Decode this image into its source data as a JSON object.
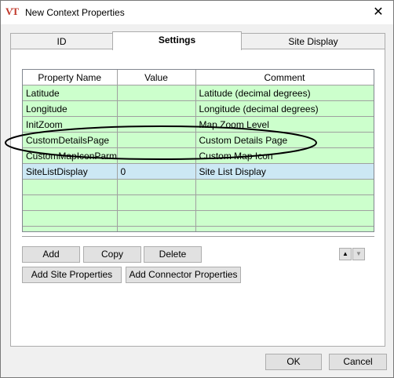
{
  "window": {
    "title": "New Context Properties",
    "app_icon": "VT",
    "close_glyph": "✕"
  },
  "tabs": [
    {
      "label": "ID"
    },
    {
      "label": "Settings"
    },
    {
      "label": "Site Display"
    }
  ],
  "active_tab": "Settings",
  "grid": {
    "columns": [
      "Property Name",
      "Value",
      "Comment"
    ],
    "rows": [
      {
        "name": "Latitude",
        "value": "",
        "comment": "Latitude (decimal degrees)"
      },
      {
        "name": "Longitude",
        "value": "",
        "comment": "Longitude (decimal degrees)"
      },
      {
        "name": "InitZoom",
        "value": "",
        "comment": "Map Zoom Level"
      },
      {
        "name": "CustomDetailsPage",
        "value": "",
        "comment": "Custom Details Page"
      },
      {
        "name": "CustomMapIconParm",
        "value": "",
        "comment": "Custom Map Icon"
      },
      {
        "name": "SiteListDisplay",
        "value": "0",
        "comment": "Site List Display"
      }
    ],
    "selected_row": "SiteListDisplay",
    "empty_row_count": 4,
    "row_color": "#ccffcc",
    "selected_color": "#cce8f4"
  },
  "buttons": {
    "add": "Add",
    "copy": "Copy",
    "delete": "Delete",
    "add_site_properties": "Add Site Properties",
    "add_connector_properties": "Add Connector Properties",
    "move_up": "up-arrow-icon",
    "move_down": "down-arrow-icon",
    "ok": "OK",
    "cancel": "Cancel"
  }
}
